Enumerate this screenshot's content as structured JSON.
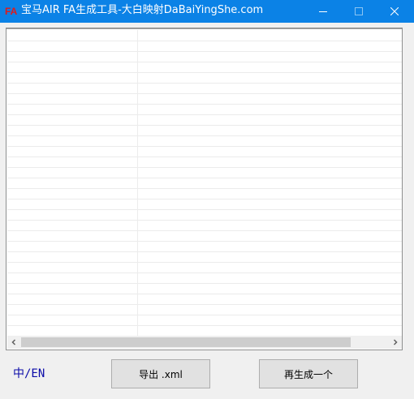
{
  "window": {
    "icon_text": "FA",
    "title": "宝马AIR FA生成工具-大白映射DaBaiYingShe.com"
  },
  "controls": {
    "minimize_icon": "minimize-icon",
    "maximize_icon": "maximize-icon",
    "close_icon": "close-icon"
  },
  "listview": {
    "rows": [],
    "scroll_left_icon": "chevron-left-icon",
    "scroll_right_icon": "chevron-right-icon"
  },
  "footer": {
    "lang_toggle": "中/EN",
    "export_button": "导出 .xml",
    "regenerate_button": "再生成一个"
  },
  "colors": {
    "titlebar": "#0b82e6",
    "lang_link": "#0a0aa8",
    "icon_red": "#e11a1a"
  }
}
